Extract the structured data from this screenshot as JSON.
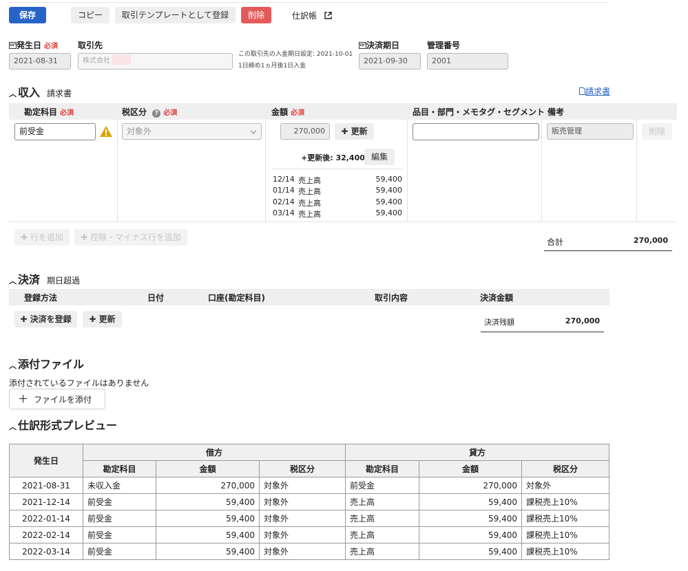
{
  "toolbar": {
    "save": "保存",
    "copy": "コピー",
    "register_template": "取引テンプレートとして登録",
    "delete": "削除",
    "journal_link": "仕訳帳"
  },
  "header": {
    "issue_date_label": "発生日",
    "required": "必須",
    "issue_date_value": "2021-08-31",
    "partner_label": "取引先",
    "partner_value": "株式会社",
    "partner_note_1": "この取引先の入金期日設定: 2021-10-01",
    "partner_note_2": "1日締め1ヵ月後1日入金",
    "due_date_label": "決済期日",
    "due_date_value": "2021-09-30",
    "manage_no_label": "管理番号",
    "manage_no_value": "2001"
  },
  "income": {
    "title": "収入",
    "subtitle": "請求書",
    "invoice_link": "請求書",
    "columns": {
      "account": "勘定科目",
      "tax": "税区分",
      "amount": "金額",
      "items": "品目・部門・メモタグ・セグメント",
      "remarks": "備考"
    },
    "row": {
      "account": "前受金",
      "tax": "対象外",
      "amount": "270,000",
      "update_btn": "更新",
      "after_update": "+更新後: 32,400",
      "edit_btn": "編集",
      "items": "",
      "remarks": "販売管理",
      "delete_btn": "削除"
    },
    "schedule": [
      {
        "date": "12/14",
        "account": "売上高",
        "amount": "59,400"
      },
      {
        "date": "01/14",
        "account": "売上高",
        "amount": "59,400"
      },
      {
        "date": "02/14",
        "account": "売上高",
        "amount": "59,400"
      },
      {
        "date": "03/14",
        "account": "売上高",
        "amount": "59,400"
      }
    ],
    "add_row": "行を追加",
    "add_minus_row": "控除・マイナス行を追加",
    "total_label": "合計",
    "total_value": "270,000"
  },
  "settlement": {
    "title": "決済",
    "subtitle": "期日超過",
    "columns": {
      "method": "登録方法",
      "date": "日付",
      "account": "口座(勘定科目)",
      "content": "取引内容",
      "amount": "決済金額"
    },
    "register_btn": "決済を登録",
    "update_btn": "更新",
    "balance_label": "決済残額",
    "balance_value": "270,000"
  },
  "attachments": {
    "title": "添付ファイル",
    "empty_text": "添付されているファイルはありません",
    "attach_btn": "ファイルを添付"
  },
  "preview": {
    "title": "仕訳形式プレビュー",
    "date_header": "発生日",
    "debit": "借方",
    "credit": "貸方",
    "sub_headers": {
      "account": "勘定科目",
      "amount": "金額",
      "tax": "税区分"
    },
    "rows": [
      {
        "date": "2021-08-31",
        "d_account": "未収入金",
        "d_amount": "270,000",
        "d_tax": "対象外",
        "c_account": "前受金",
        "c_amount": "270,000",
        "c_tax": "対象外"
      },
      {
        "date": "2021-12-14",
        "d_account": "前受金",
        "d_amount": "59,400",
        "d_tax": "対象外",
        "c_account": "売上高",
        "c_amount": "59,400",
        "c_tax": "課税売上10%"
      },
      {
        "date": "2022-01-14",
        "d_account": "前受金",
        "d_amount": "59,400",
        "d_tax": "対象外",
        "c_account": "売上高",
        "c_amount": "59,400",
        "c_tax": "課税売上10%"
      },
      {
        "date": "2022-02-14",
        "d_account": "前受金",
        "d_amount": "59,400",
        "d_tax": "対象外",
        "c_account": "売上高",
        "c_amount": "59,400",
        "c_tax": "課税売上10%"
      },
      {
        "date": "2022-03-14",
        "d_account": "前受金",
        "d_amount": "59,400",
        "d_tax": "対象外",
        "c_account": "売上高",
        "c_amount": "59,400",
        "c_tax": "課税売上10%"
      }
    ]
  },
  "colors": {
    "primary": "#2864c8",
    "danger": "#e45a5a",
    "required": "#e04040",
    "warning": "#d9a400"
  }
}
